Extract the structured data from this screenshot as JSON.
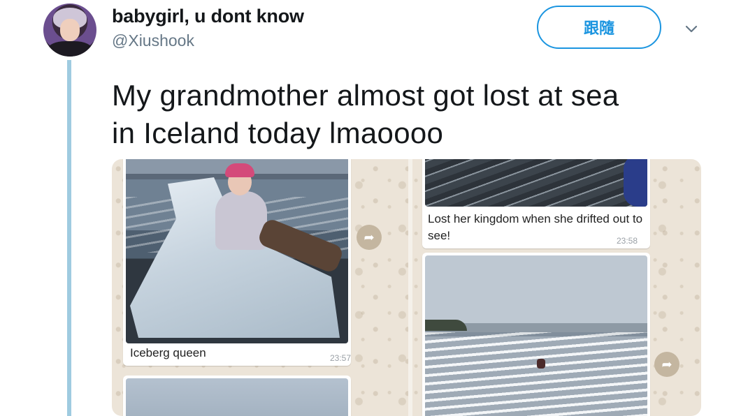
{
  "user": {
    "display_name": "babygirl, u dont know",
    "handle": "@Xiushook"
  },
  "actions": {
    "follow_label": "跟隨"
  },
  "tweet": {
    "text_line1": "My grandmother almost got lost at sea",
    "text_line2": "in Iceland today lmaoooo"
  },
  "media": {
    "messages": [
      {
        "caption": "Iceberg queen",
        "time": "23:57"
      },
      {
        "caption": "Lost her kingdom when she drifted out to see!",
        "time": "23:58"
      }
    ]
  },
  "colors": {
    "accent": "#1b95e0",
    "thread_line": "#9fcbe0",
    "chat_background": "#ece4d8"
  },
  "icons": {
    "more": "chevron-down-icon",
    "forward": "forward-icon"
  }
}
